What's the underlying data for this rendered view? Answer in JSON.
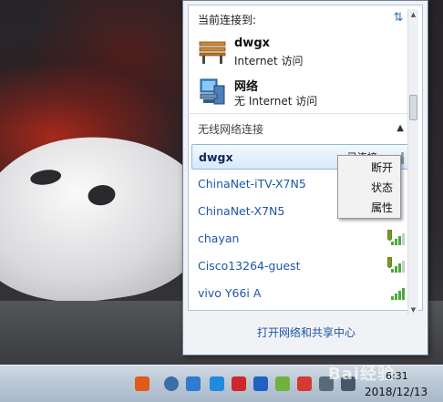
{
  "flyout": {
    "header": "当前连接到:",
    "connections": [
      {
        "name": "dwgx",
        "status": "Internet 访问",
        "icon": "bench-icon"
      },
      {
        "name": "网络",
        "status": "无 Internet 访问",
        "icon": "network-icon"
      }
    ],
    "wireless_section_title": "无线网络连接",
    "networks": [
      {
        "name": "dwgx",
        "status": "已连接",
        "selected": true,
        "secured": false,
        "signal": 4
      },
      {
        "name": "ChinaNet-iTV-X7N5",
        "status": "",
        "selected": false,
        "secured": false,
        "signal": 4
      },
      {
        "name": "ChinaNet-X7N5",
        "status": "",
        "selected": false,
        "secured": false,
        "signal": 4
      },
      {
        "name": "chayan",
        "status": "",
        "selected": false,
        "secured": true,
        "signal": 3
      },
      {
        "name": "Cisco13264-guest",
        "status": "",
        "selected": false,
        "secured": true,
        "signal": 3
      },
      {
        "name": "vivo Y66i A",
        "status": "",
        "selected": false,
        "secured": false,
        "signal": 4
      }
    ],
    "footer_link": "打开网络和共享中心"
  },
  "context_menu": {
    "items": [
      "断开",
      "状态",
      "属性"
    ]
  },
  "taskbar": {
    "time": "6:31",
    "date": "2018/12/13"
  },
  "colors": {
    "link_blue": "#1f56a8",
    "signal_green": "#4caa3a",
    "selection_border": "#8fb6e2"
  }
}
